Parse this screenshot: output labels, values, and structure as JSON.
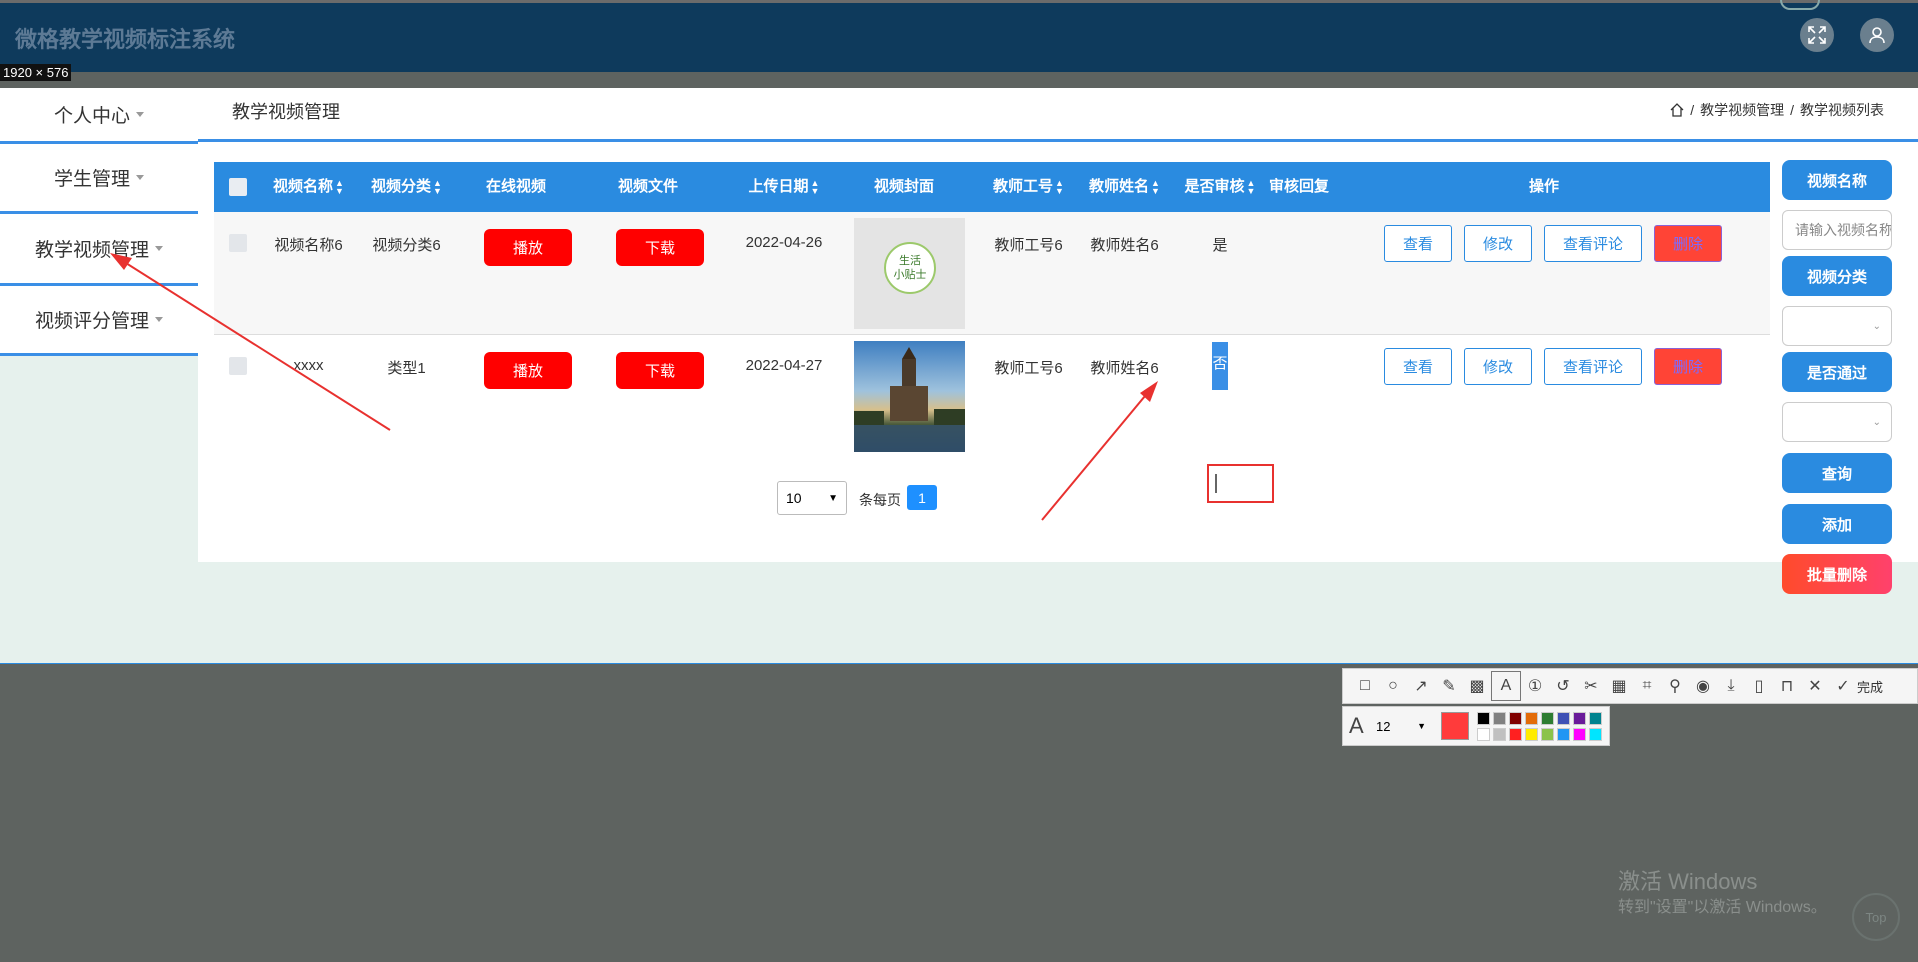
{
  "header": {
    "app_title": "微格教学视频标注系统",
    "size_tag": "1920 × 576"
  },
  "sidebar": {
    "items": [
      {
        "label": "个人中心"
      },
      {
        "label": "学生管理"
      },
      {
        "label": "教学视频管理"
      },
      {
        "label": "视频评分管理"
      }
    ]
  },
  "page": {
    "title": "教学视频管理",
    "breadcrumb": [
      "教学视频管理",
      "教学视频列表"
    ]
  },
  "table": {
    "headers": [
      "视频名称",
      "视频分类",
      "在线视频",
      "视频文件",
      "上传日期",
      "视频封面",
      "教师工号",
      "教师姓名",
      "是否审核",
      "审核回复",
      "操作"
    ],
    "rows": [
      {
        "name": "视频名称6",
        "category": "视频分类6",
        "play": "播放",
        "download": "下载",
        "date": "2022-04-26",
        "cover_text": "生活\n小贴士",
        "teacher_no": "教师工号6",
        "teacher_name": "教师姓名6",
        "audited": "是",
        "reply": ""
      },
      {
        "name": "xxxx",
        "category": "类型1",
        "play": "播放",
        "download": "下载",
        "date": "2022-04-27",
        "cover_text": "",
        "teacher_no": "教师工号6",
        "teacher_name": "教师姓名6",
        "audited": "否",
        "reply": ""
      }
    ],
    "actions": {
      "view": "查看",
      "edit": "修改",
      "comments": "查看评论",
      "delete": "删除"
    }
  },
  "pagination": {
    "page_size": "10",
    "per_page_label": "条每页",
    "current_page": "1"
  },
  "filters": {
    "name_label": "视频名称",
    "name_placeholder": "请输入视频名称",
    "category_label": "视频分类",
    "pass_label": "是否通过",
    "query": "查询",
    "add": "添加",
    "batch_delete": "批量删除"
  },
  "screenshot_tool": {
    "done": "完成",
    "font_size": "12"
  },
  "watermark": {
    "line1": "激活 Windows",
    "line2": "转到\"设置\"以激活 Windows。"
  },
  "top_button": "Top",
  "colors": {
    "accent": "#2a8be0",
    "danger": "#ff0000",
    "header": "#0e3a5c",
    "annotation": "#e8312f"
  }
}
